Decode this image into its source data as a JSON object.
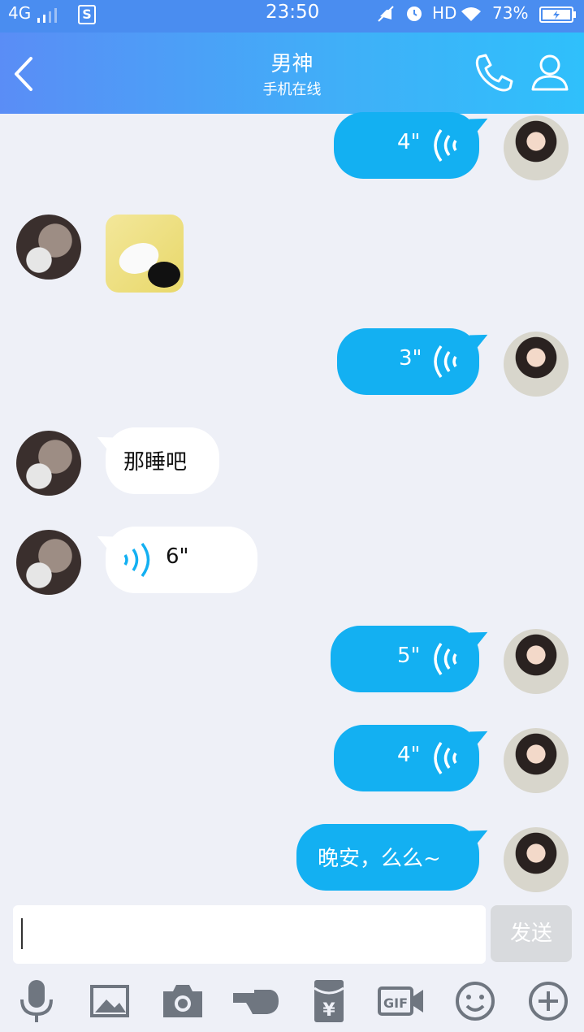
{
  "status": {
    "network": "4G",
    "sim_badge": "S",
    "time": "23:50",
    "hd": "HD",
    "battery": "73%"
  },
  "header": {
    "title": "男神",
    "subtitle": "手机在线"
  },
  "messages": [
    {
      "side": "out",
      "kind": "voice",
      "duration": "4\""
    },
    {
      "side": "in",
      "kind": "image"
    },
    {
      "side": "out",
      "kind": "voice",
      "duration": "3\""
    },
    {
      "side": "in",
      "kind": "text",
      "text": "那睡吧"
    },
    {
      "side": "in",
      "kind": "voice",
      "duration": "6\""
    },
    {
      "side": "out",
      "kind": "voice",
      "duration": "5\""
    },
    {
      "side": "out",
      "kind": "voice",
      "duration": "4\""
    },
    {
      "side": "out",
      "kind": "text",
      "text": "晚安，么么~"
    }
  ],
  "input": {
    "send_label": "发送"
  },
  "toolbar": {
    "icons": [
      "microphone-icon",
      "image-icon",
      "camera-icon",
      "poke-hand-icon",
      "red-packet-icon",
      "gif-icon",
      "emoji-icon",
      "plus-icon"
    ]
  },
  "colors": {
    "accent": "#13b0f2",
    "header_start": "#5a8df6",
    "header_end": "#2fc0fb",
    "background": "#eef0f7"
  }
}
